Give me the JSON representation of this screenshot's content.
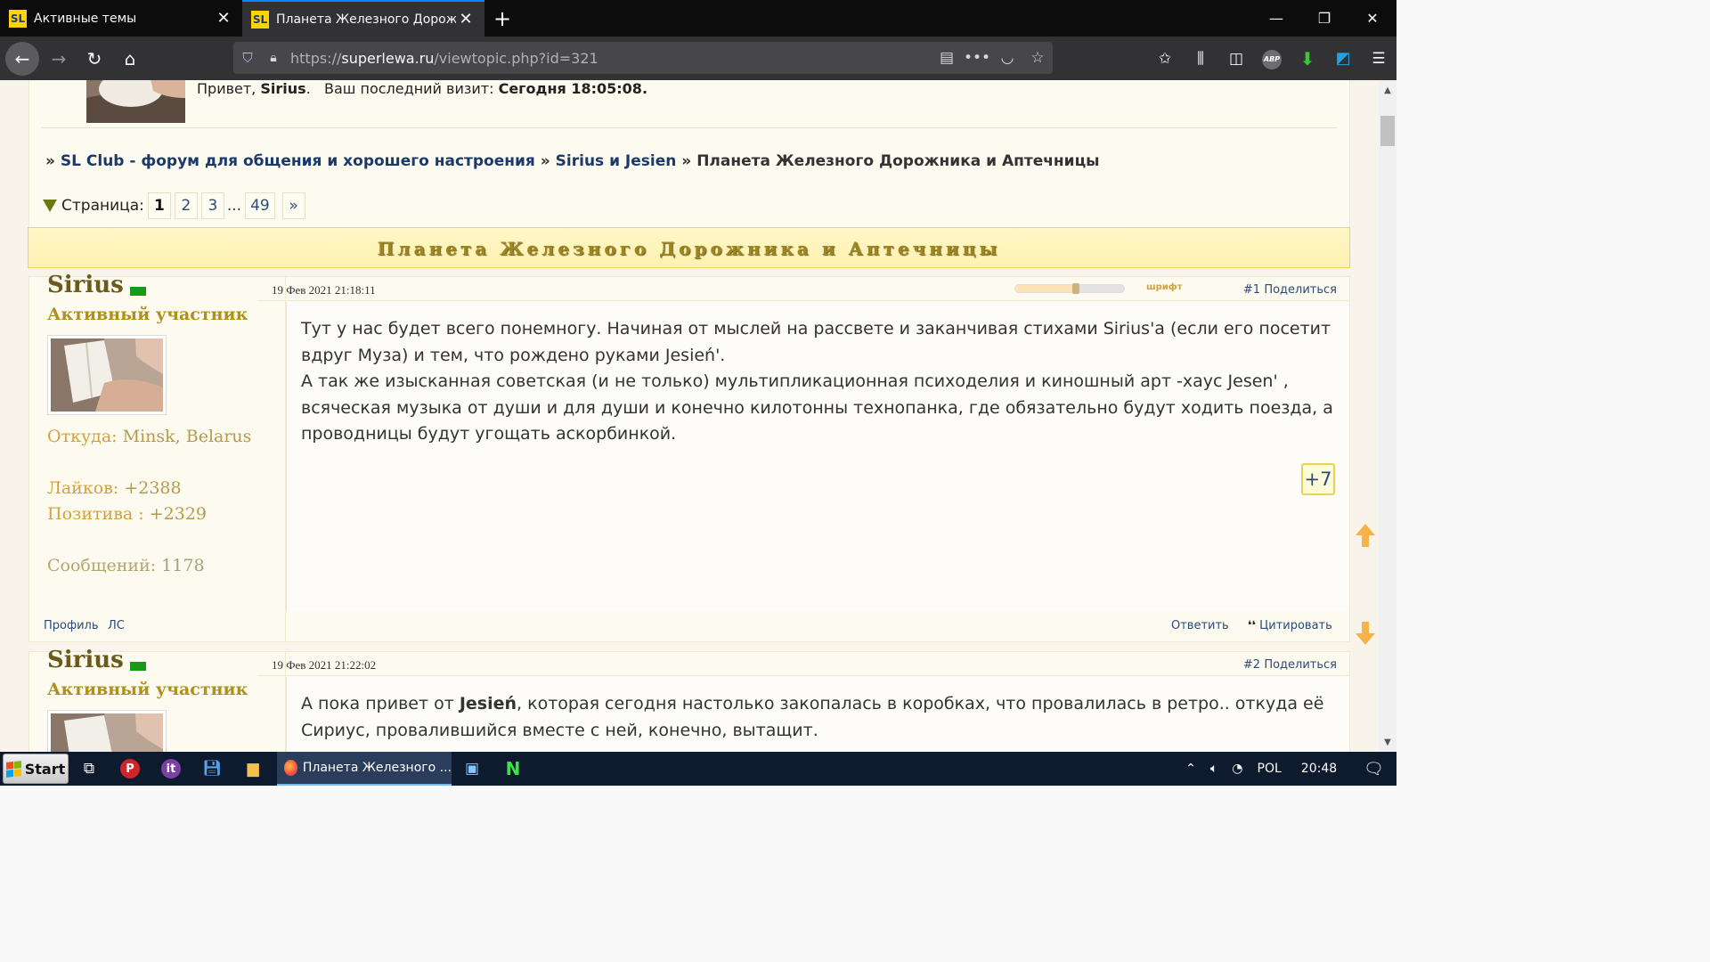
{
  "browser": {
    "tabs": [
      {
        "title": "Активные темы",
        "favicon": "SL",
        "active": false
      },
      {
        "title": "Планета Железного Дорожни",
        "favicon": "SL",
        "active": true
      }
    ],
    "url": {
      "prefix": "https://",
      "domain": "superlewa.ru",
      "path": "/viewtopic.php?id=321"
    },
    "accent_color": "#0a84ff"
  },
  "header": {
    "greeting_prefix": "Привет,",
    "username": "Sirius",
    "last_visit_label": "Ваш последний визит:",
    "last_visit_value": "Сегодня 18:05:08."
  },
  "breadcrumbs": {
    "sep": "»",
    "items": [
      "SL Club - форум для общения и хорошего настроения",
      "Sirius и Jesien",
      "Планета Железного Дорожника и Аптечницы"
    ]
  },
  "pager": {
    "label": "Страница:",
    "pages": [
      "1",
      "2",
      "3"
    ],
    "ellipsis": "...",
    "last": "49",
    "next": "»"
  },
  "topic": {
    "title": "Планета Железного Дорожника и Аптечницы"
  },
  "posts": [
    {
      "author": "Sirius",
      "rank": "Активный участник",
      "from_label": "Откуда:",
      "from_value": "Minsk, Belarus",
      "likes_label": "Лайков:",
      "likes_value": "+2388",
      "positive_label": "Позитива :",
      "positive_value": "+2329",
      "messages_label": "Сообщений:",
      "messages_value": "1178",
      "date": "19 Фев 2021 21:18:11",
      "font_label": "шрифт",
      "font_slider_level": 0.55,
      "number": "#1",
      "share": "Поделиться",
      "paragraphs": [
        "Тут у нас будет всего понемногу. Начиная от мыслей на рассвете и заканчивая стихами Sirius'a (если его посетит вдруг Муза) и тем, что рождено руками Jesień'.",
        "А так же изысканная советская (и не только) мультипликационная психоделия и киношный арт -хаус Jesen' , всяческая музыка от души и для души и конечно килотонны технопанка, где обязательно будут ходить поезда, а проводницы будут угощать аскорбинкой."
      ],
      "like_count": "+7",
      "profile": "Профиль",
      "pm": "ЛС",
      "reply": "Ответить",
      "quote": "Цитировать"
    },
    {
      "author": "Sirius",
      "rank": "Активный участник",
      "date": "19 Фев 2021 21:22:02",
      "number": "#2",
      "share": "Поделиться",
      "text_prefix": "А пока привет от ",
      "text_bold": "Jesień",
      "text_suffix": ", которая сегодня настолько закопалась в коробках, что провалилась в ретро.. откуда её Сириус, провалившийся вместе с ней, конечно, вытащит."
    }
  ],
  "taskbar": {
    "start": "Start",
    "task_title": "Планета Железного ...",
    "language": "POL",
    "time": "20:48"
  }
}
